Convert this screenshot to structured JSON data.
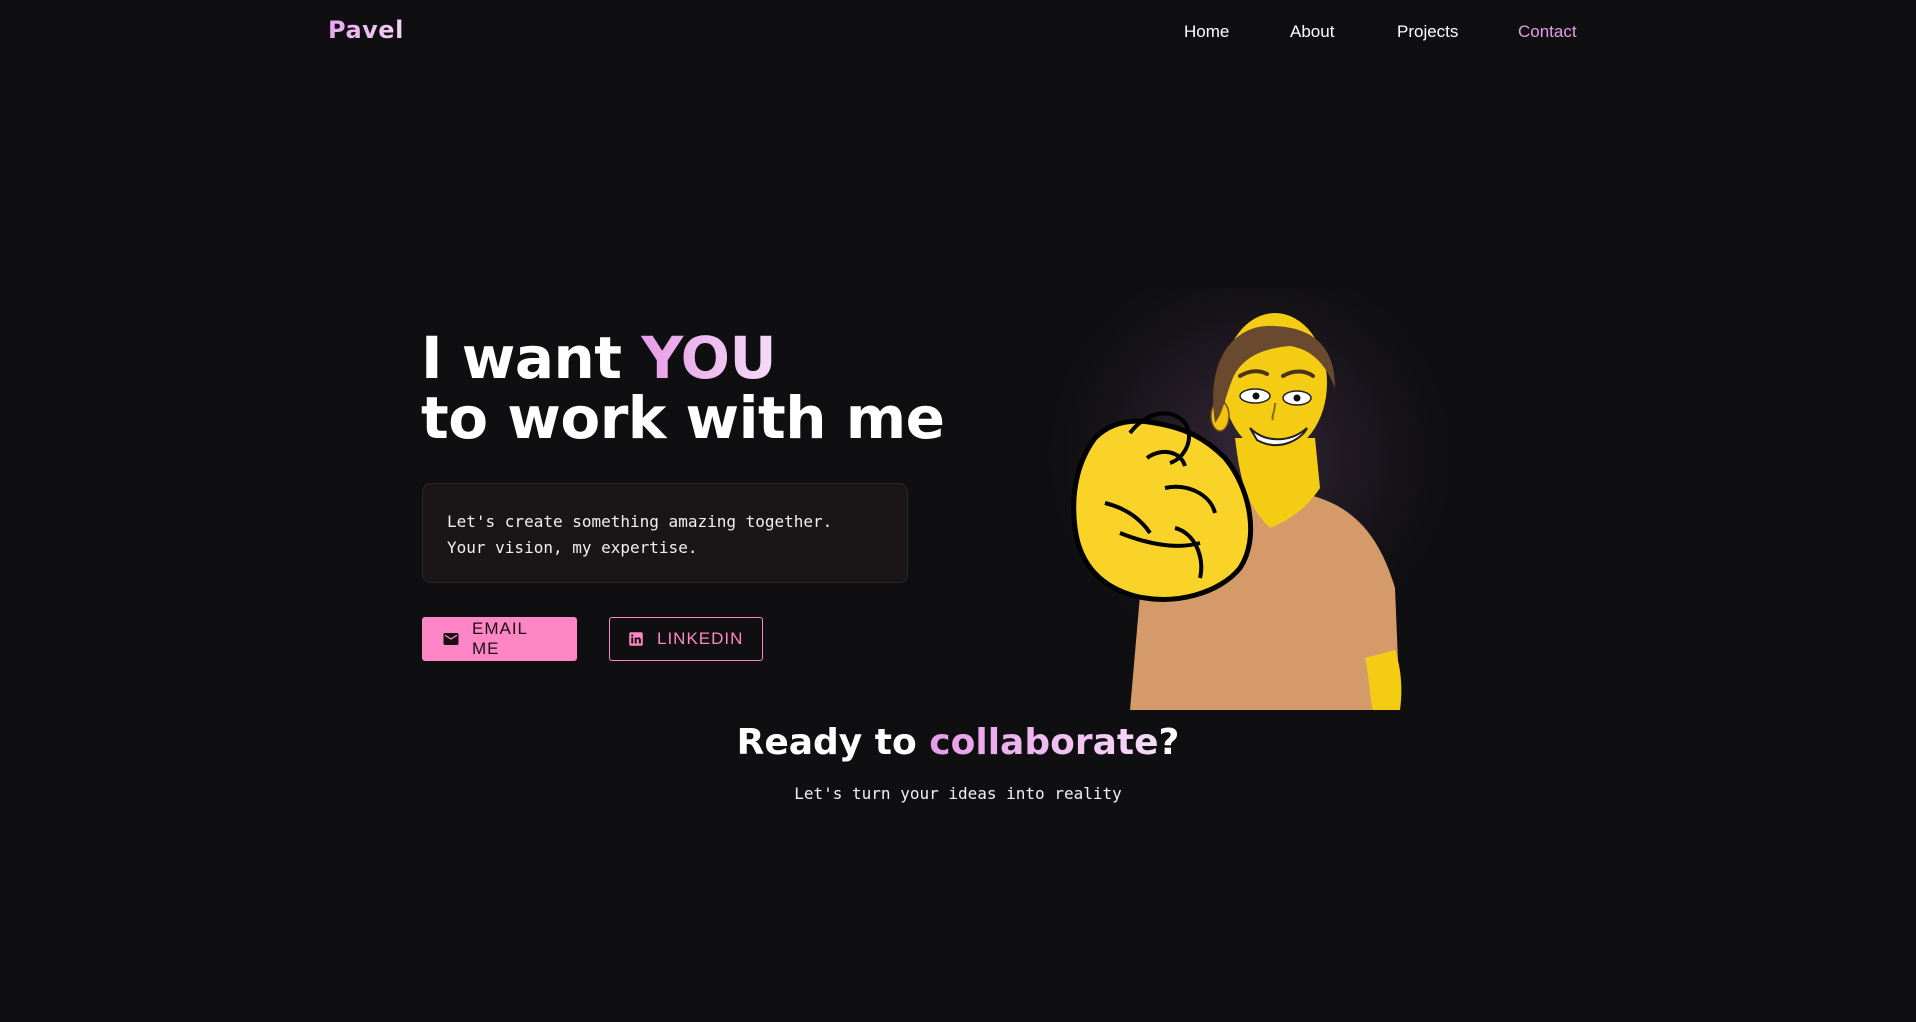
{
  "nav": {
    "logo": "Pavel",
    "links": [
      "Home",
      "About",
      "Projects",
      "Contact"
    ],
    "active_link": "Contact"
  },
  "hero": {
    "title_line1_prefix": "I want ",
    "title_line1_accent": "YOU",
    "title_line2": "to work with me",
    "message_line1": "Let's create something amazing together.",
    "message_line2": "Your vision, my expertise.",
    "email_button": "EMAIL ME",
    "linkedin_button": "LINKEDIN"
  },
  "cta": {
    "title_prefix": "Ready to ",
    "title_accent": "collaborate",
    "title_suffix": "?",
    "subtitle": "Let's turn your ideas into reality"
  },
  "icons": {
    "email": "mail-icon",
    "linkedin": "linkedin-icon"
  },
  "colors": {
    "background": "#0f0f11",
    "accent_pink": "#ff86c6",
    "accent_lilac": "#e79be8",
    "text": "#ffffff"
  }
}
